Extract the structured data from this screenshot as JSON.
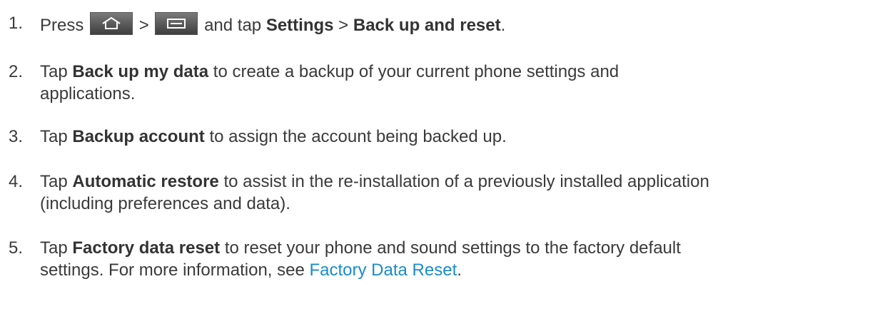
{
  "steps": [
    {
      "num": "1.",
      "t1": "Press",
      "gt": ">",
      "t2": "and tap",
      "b1": "Settings",
      "gt2": ">",
      "b2": "Back up and reset",
      "end": "."
    },
    {
      "num": "2.",
      "t1": "Tap",
      "b1": "Back up my data",
      "t2": "to create a backup of your current phone settings and",
      "t3": "applications."
    },
    {
      "num": "3.",
      "t1": "Tap",
      "b1": "Backup account",
      "t2": "to assign the account being backed up."
    },
    {
      "num": "4.",
      "t1": "Tap",
      "b1": "Automatic restore",
      "t2": "to assist in the re-installation of a previously installed application",
      "t3": "(including preferences and data)."
    },
    {
      "num": "5.",
      "t1": "Tap",
      "b1": "Factory data reset",
      "t2": "to reset your phone and sound settings to the factory default",
      "t3": "settings. For more information, see",
      "link": "Factory Data Reset",
      "end": "."
    }
  ],
  "icons": {
    "home": "home-key-icon",
    "menu": "menu-key-icon"
  },
  "colors": {
    "text": "#3a3a3a",
    "link": "#1a8ccc"
  }
}
